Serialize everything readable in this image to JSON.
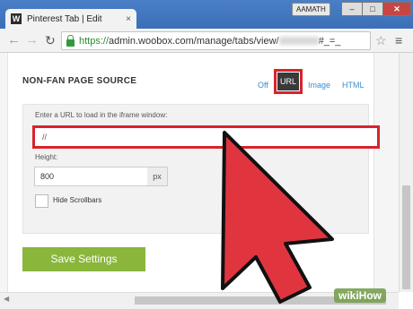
{
  "browser": {
    "tab_title": "Pinterest Tab | Edit",
    "tab_icon_letter": "W",
    "tab_close": "×",
    "user_badge": "AAMATH",
    "url_scheme": "https://",
    "url_path": "admin.woobox.com/manage/tabs/view/",
    "url_suffix": "#_=_"
  },
  "section": {
    "title": "NON-FAN PAGE SOURCE",
    "options": [
      "Off",
      "URL",
      "Image",
      "HTML"
    ],
    "selected": "URL"
  },
  "form": {
    "url_label": "Enter a URL to load in the iframe window:",
    "url_value": "//",
    "height_label": "Height:",
    "height_value": "800",
    "height_unit": "px",
    "hide_scrollbars_label": "Hide Scrollbars",
    "save_label": "Save Settings"
  },
  "colors": {
    "highlight": "#d8232a",
    "save_button": "#8ab63c",
    "cursor": "#e0353f",
    "link": "#3a8ed1"
  },
  "watermark": "wikiHow"
}
